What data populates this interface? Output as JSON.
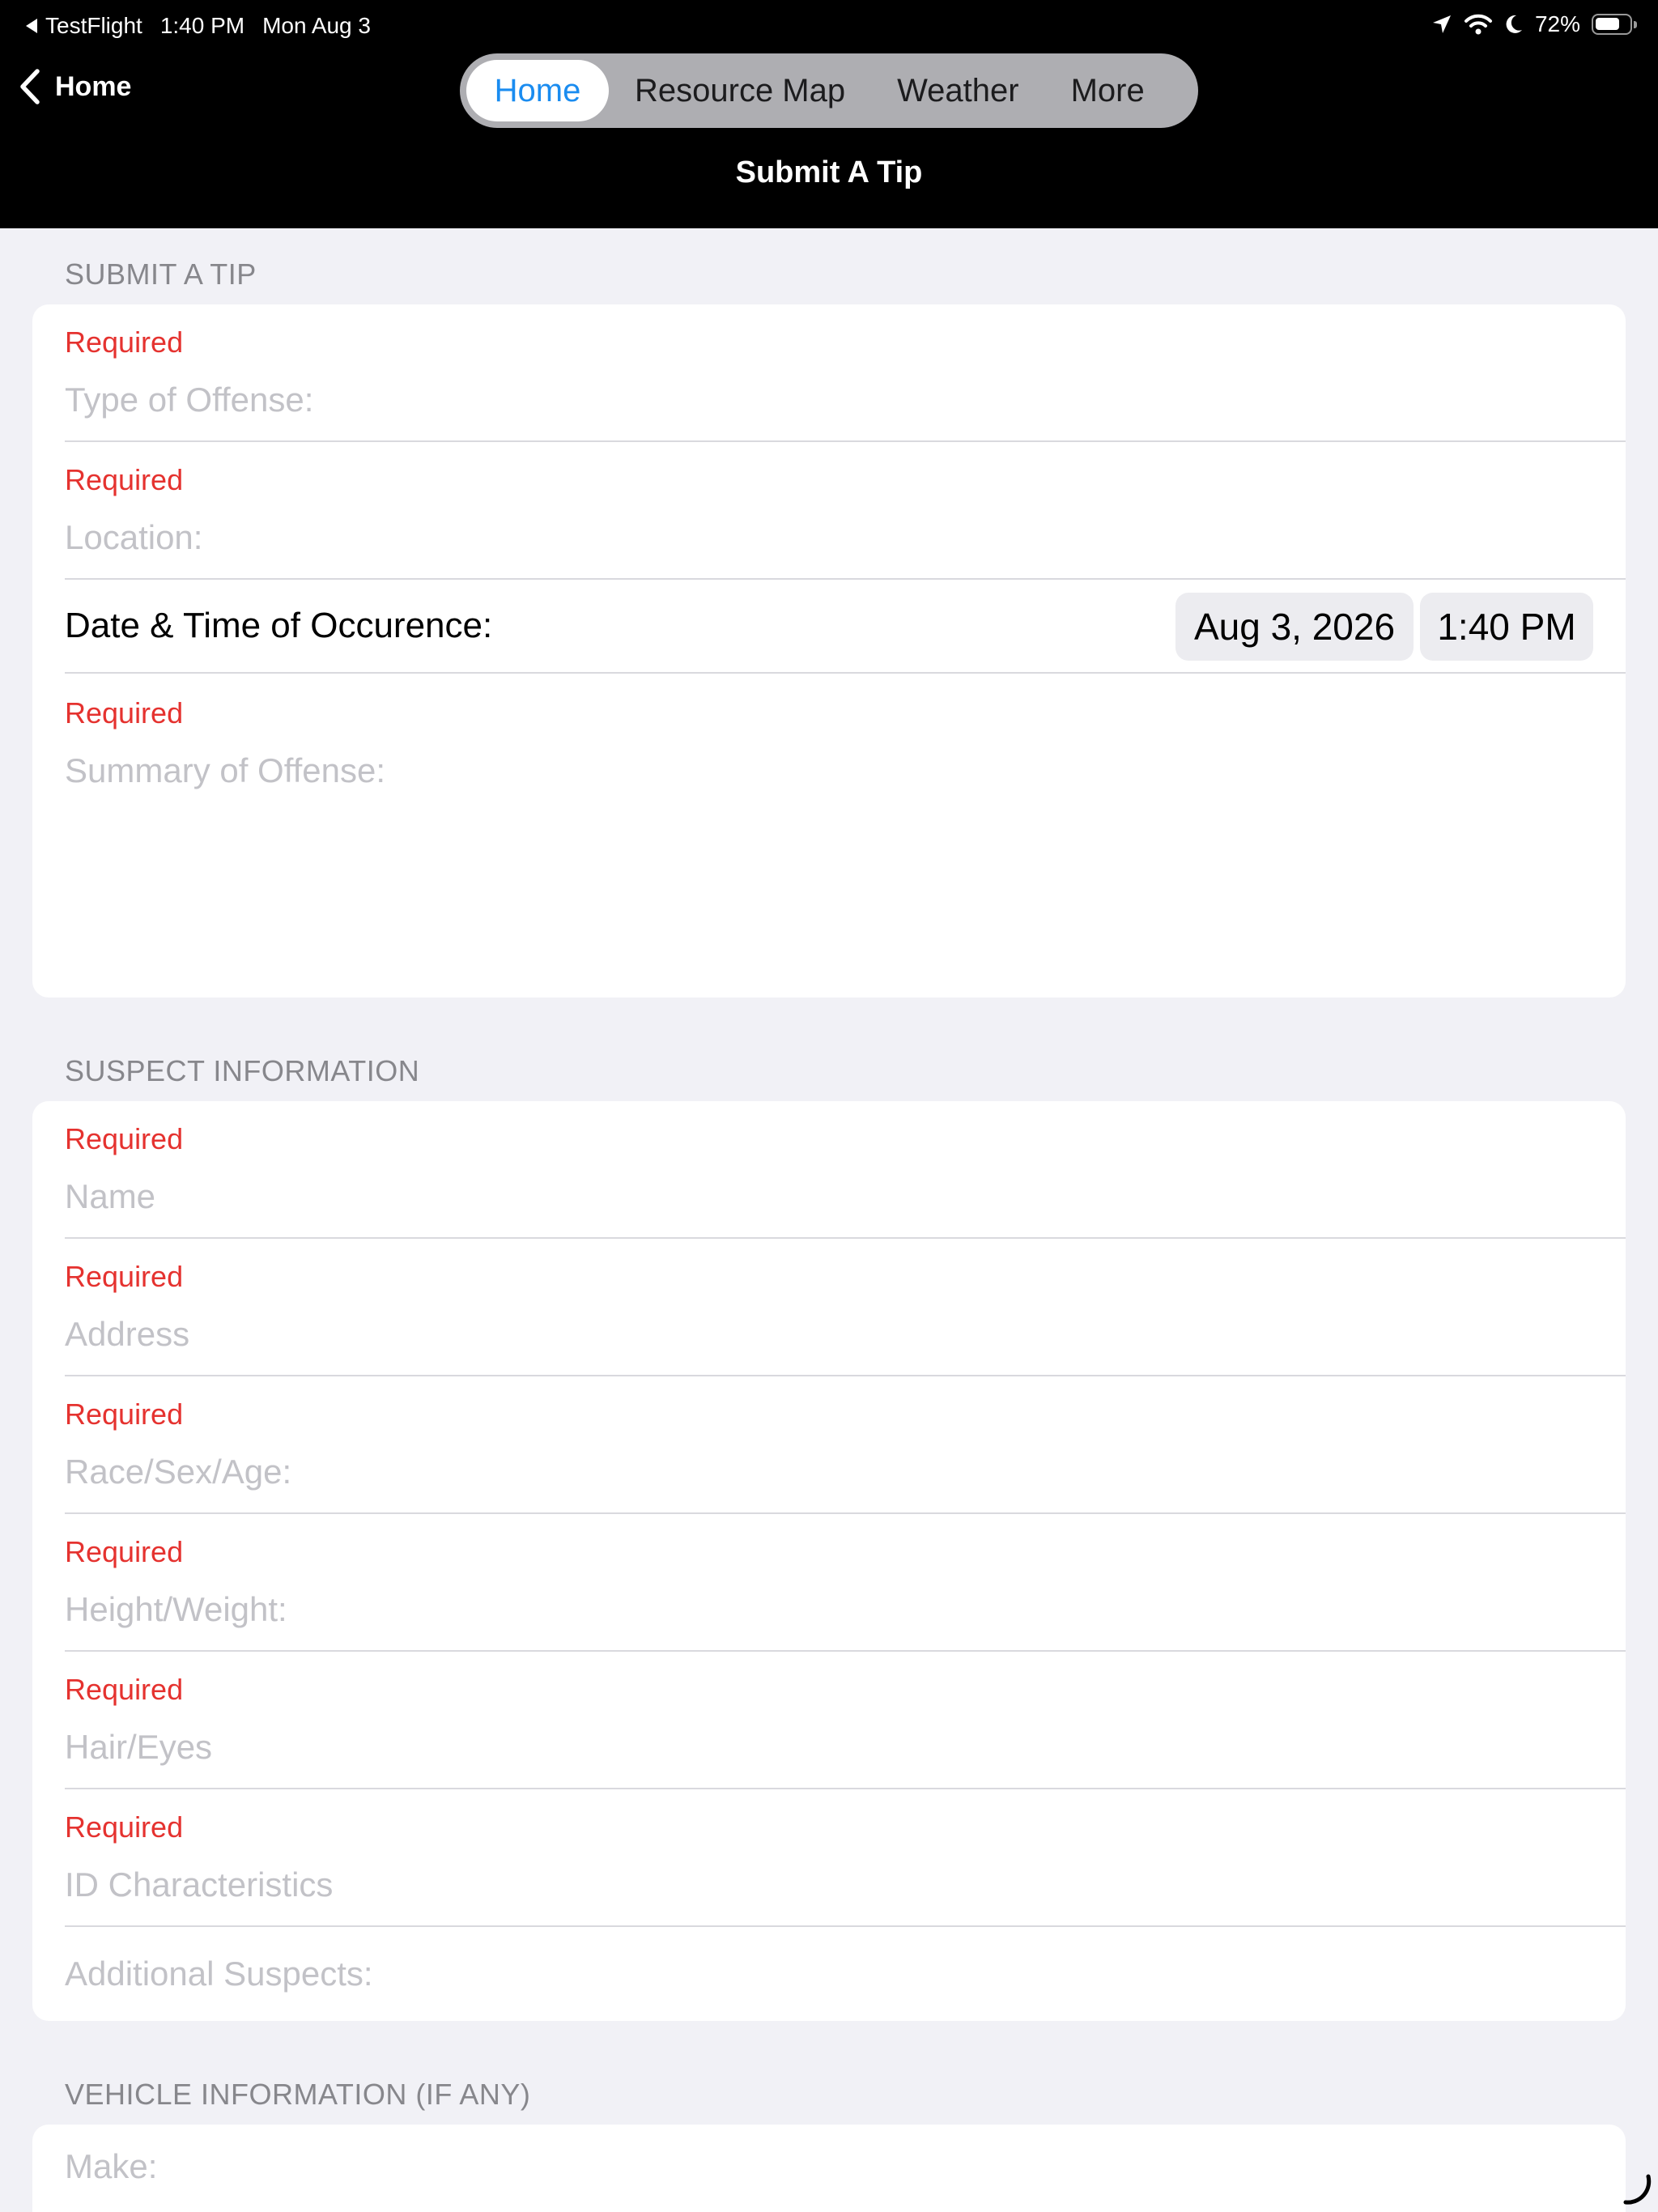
{
  "status_bar": {
    "back_app": "TestFlight",
    "time": "1:40 PM",
    "date": "Mon Aug 3",
    "battery": "72%",
    "battery_level": 0.72
  },
  "nav": {
    "back_label": "Home",
    "title": "Submit A Tip",
    "segments": [
      "Home",
      "Resource Map",
      "Weather",
      "More"
    ],
    "selected_segment": "Home"
  },
  "colors": {
    "accent": "#1a8cf0",
    "required": "#e5322f",
    "placeholder": "#c2c2c7",
    "background": "#f1f1f6"
  },
  "sections": {
    "tip": {
      "header": "SUBMIT A TIP",
      "required_label": "Required",
      "type_of_offense": "Type of Offense:",
      "location": "Location:",
      "date_time_label": "Date & Time of Occurence:",
      "date_value": "Aug 3, 2026",
      "time_value": "1:40 PM",
      "summary": "Summary of Offense:"
    },
    "suspect": {
      "header": "SUSPECT INFORMATION",
      "required_label": "Required",
      "name": "Name",
      "address": "Address",
      "race_sex_age": "Race/Sex/Age:",
      "height_weight": "Height/Weight:",
      "hair_eyes": "Hair/Eyes",
      "id_characteristics": "ID Characteristics",
      "additional_suspects": "Additional Suspects:"
    },
    "vehicle": {
      "header": "VEHICLE INFORMATION (IF ANY)",
      "make": "Make:"
    }
  }
}
